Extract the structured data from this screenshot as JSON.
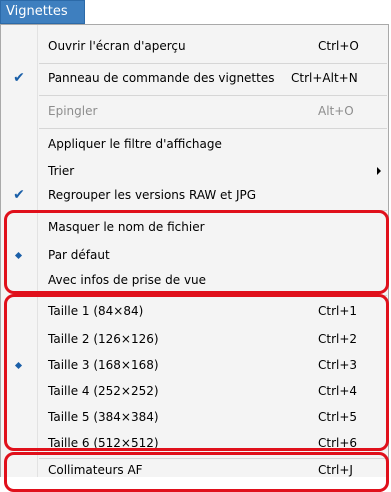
{
  "menubar": {
    "title": "Vignettes"
  },
  "menu": {
    "open_preview": {
      "label": "Ouvrir l'écran d'aperçu",
      "shortcut": "Ctrl+O"
    },
    "control_panel": {
      "label": "Panneau de commande des vignettes",
      "shortcut": "Ctrl+Alt+N",
      "checked": true
    },
    "pin": {
      "label": "Epingler",
      "shortcut": "Alt+O",
      "disabled": true
    },
    "apply_filter": {
      "label": "Appliquer le filtre d'affichage"
    },
    "sort": {
      "label": "Trier"
    },
    "group_raw_jpg": {
      "label": "Regrouper les versions RAW et JPG",
      "checked": true
    },
    "hide_filename": {
      "label": "Masquer le nom de fichier"
    },
    "default": {
      "label": "Par défaut",
      "selected": true
    },
    "shooting_info": {
      "label": "Avec infos de prise de vue"
    },
    "sizes": [
      {
        "label": "Taille 1 (84×84)",
        "shortcut": "Ctrl+1"
      },
      {
        "label": "Taille 2 (126×126)",
        "shortcut": "Ctrl+2"
      },
      {
        "label": "Taille 3 (168×168)",
        "shortcut": "Ctrl+3",
        "selected": true
      },
      {
        "label": "Taille 4 (252×252)",
        "shortcut": "Ctrl+4"
      },
      {
        "label": "Taille 5 (384×384)",
        "shortcut": "Ctrl+5"
      },
      {
        "label": "Taille 6 (512×512)",
        "shortcut": "Ctrl+6"
      }
    ],
    "af_points": {
      "label": "Collimateurs AF",
      "shortcut": "Ctrl+J"
    }
  },
  "colors": {
    "accent": "#3e7fbf",
    "highlight_box": "#e0101b"
  },
  "icons": {
    "check": "checkmark-icon",
    "radio": "radio-dot-icon",
    "submenu": "submenu-arrow-icon"
  }
}
